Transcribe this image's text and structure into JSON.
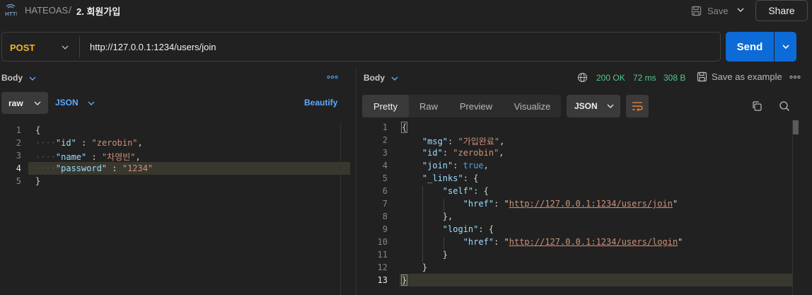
{
  "header": {
    "collection": "HATEOAS",
    "separator": "/",
    "request_name": "2. 회원가입",
    "save_label": "Save",
    "share_label": "Share"
  },
  "request": {
    "method": "POST",
    "url": "http://127.0.0.1:1234/users/join",
    "send_label": "Send"
  },
  "request_body": {
    "section_label": "Body",
    "mode": "raw",
    "format": "JSON",
    "beautify_label": "Beautify",
    "line_numbers": [
      "1",
      "2",
      "3",
      "4",
      "5"
    ],
    "lines": [
      {
        "open": "{"
      },
      {
        "key": "\"id\"",
        "sep": " : ",
        "value": "\"zerobin\"",
        "end": ","
      },
      {
        "key": "\"name\"",
        "sep": " : ",
        "value": "\"차영빈\"",
        "end": ","
      },
      {
        "key": "\"password\"",
        "sep": " : ",
        "value": "\"1234\"",
        "end": ""
      },
      {
        "open": "}"
      }
    ]
  },
  "response": {
    "section_label": "Body",
    "status": "200 OK",
    "time": "72 ms",
    "size": "308 B",
    "save_example_label": "Save as example",
    "tabs": [
      "Pretty",
      "Raw",
      "Preview",
      "Visualize"
    ],
    "active_tab": "Pretty",
    "format": "JSON",
    "line_numbers": [
      "1",
      "2",
      "3",
      "4",
      "5",
      "6",
      "7",
      "8",
      "9",
      "10",
      "11",
      "12",
      "13"
    ],
    "lines": {
      "l1": "{",
      "msg_key": "\"msg\"",
      "msg_val": "\"가입완료\"",
      "id_key": "\"id\"",
      "id_val": "\"zerobin\"",
      "join_key": "\"join\"",
      "join_val": "true",
      "links_key": "\"_links\"",
      "self_key": "\"self\"",
      "href_key": "\"href\"",
      "self_href": "http://127.0.0.1:1234/users/join",
      "login_key": "\"login\"",
      "login_href": "http://127.0.0.1:1234/users/login",
      "l13": "}"
    }
  },
  "colors": {
    "accent": "#0c6bd6",
    "method": "#f0b429",
    "status_ok": "#4ec98b",
    "link": "#5aa9ff"
  }
}
